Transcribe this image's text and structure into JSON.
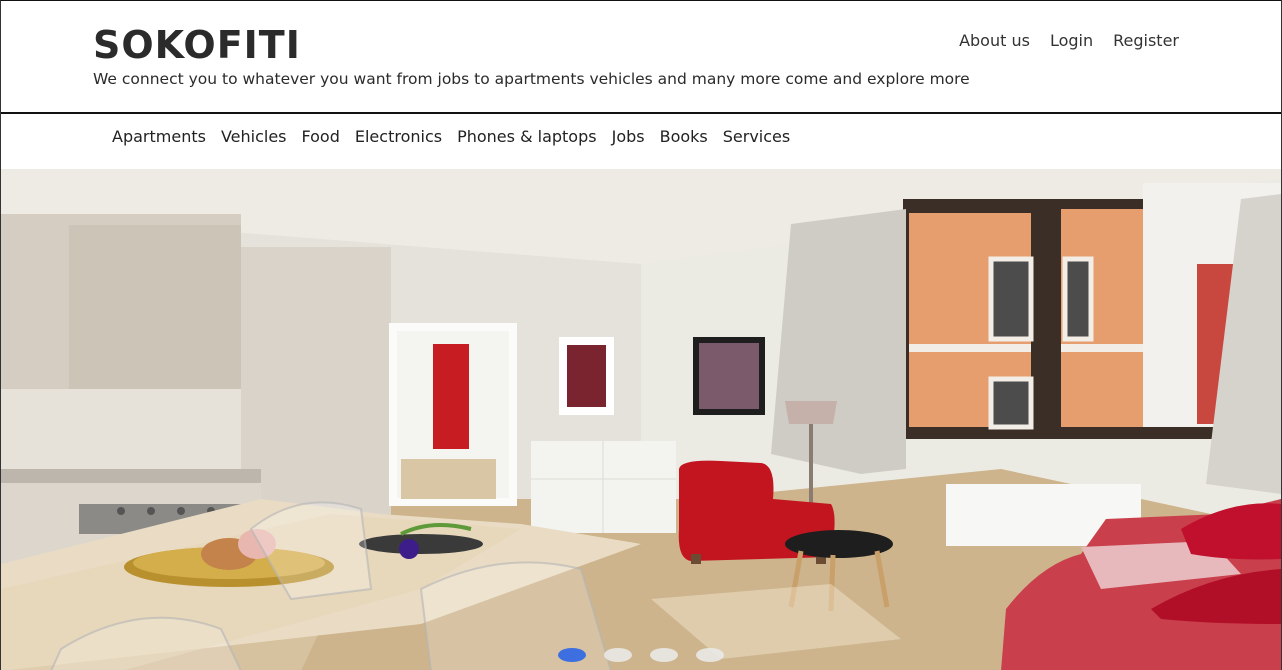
{
  "header": {
    "brand": "SOKOFITI",
    "tagline": "We connect you to whatever you want from jobs to apartments vehicles and many more come and explore more",
    "links": [
      "About us",
      "Login",
      "Register"
    ]
  },
  "categories": [
    "Apartments",
    "Vehicles",
    "Food",
    "Electronics",
    "Phones & laptops",
    "Jobs",
    "Books",
    "Services"
  ],
  "carousel": {
    "slide_count": 4,
    "active_index": 0,
    "colors": {
      "active": "#3d6fe0",
      "inactive": "#ebebeb"
    }
  }
}
